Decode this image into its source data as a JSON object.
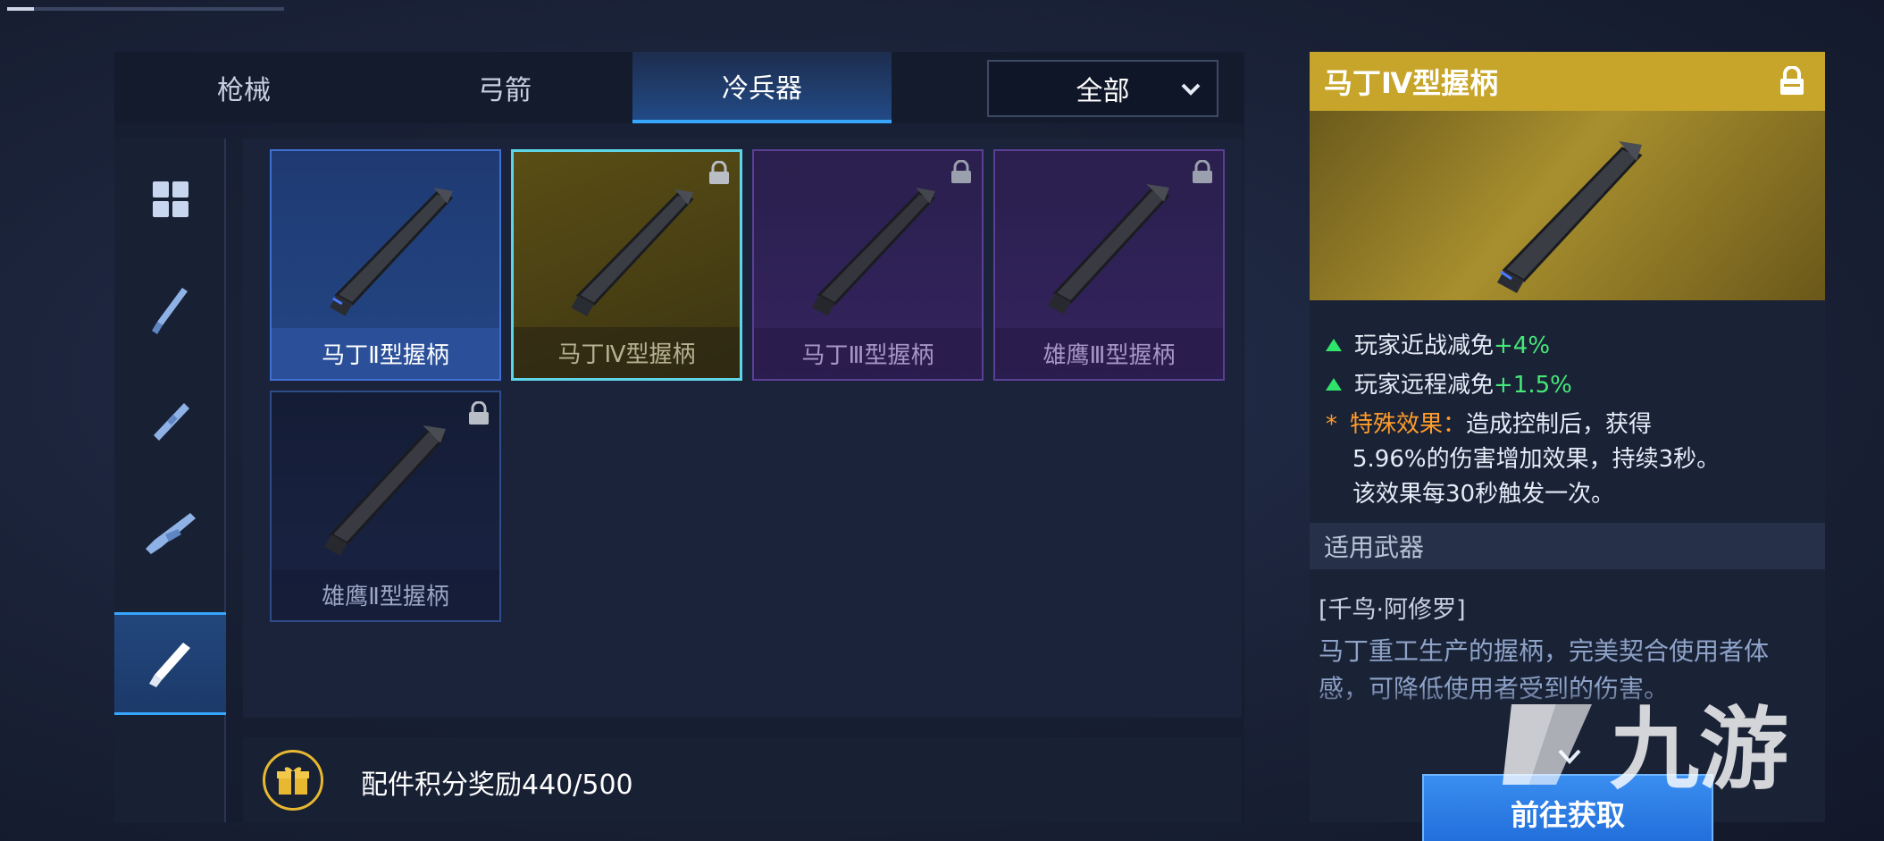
{
  "tabs": [
    {
      "label": "枪械",
      "active": false
    },
    {
      "label": "弓箭",
      "active": false
    },
    {
      "label": "冷兵器",
      "active": true
    }
  ],
  "filter": {
    "selected": "全部"
  },
  "category_icons": [
    "grid-icon",
    "blade-icon",
    "baton-icon",
    "rifle-icon",
    "grip-icon"
  ],
  "items": [
    {
      "name": "马丁Ⅱ型握柄",
      "rarity": "blue",
      "locked": false,
      "selected": false
    },
    {
      "name": "马丁Ⅳ型握柄",
      "rarity": "gold",
      "locked": true,
      "selected": true
    },
    {
      "name": "马丁Ⅲ型握柄",
      "rarity": "purple",
      "locked": true,
      "selected": false
    },
    {
      "name": "雄鹰Ⅲ型握柄",
      "rarity": "purple",
      "locked": true,
      "selected": false
    },
    {
      "name": "雄鹰Ⅱ型握柄",
      "rarity": "navy",
      "locked": true,
      "selected": false
    }
  ],
  "reward": {
    "text": "配件积分奖励440/500"
  },
  "detail": {
    "title": "马丁Ⅳ型握柄",
    "stats": [
      {
        "label": "玩家近战减免",
        "value": "+4%"
      },
      {
        "label": "玩家远程减免",
        "value": "+1.5%"
      }
    ],
    "special_key": "特殊效果：",
    "special_line1": "造成控制后，获得",
    "special_line2": "5.96%的伤害增加效果，持续3秒。",
    "special_line3": "该效果每30秒触发一次。",
    "applicable_title": "适用武器",
    "weapon": "[千鸟·阿修罗]",
    "description": "马丁重工生产的握柄，完美契合使用者体感，可降低使用者受到的伤害。",
    "acquire_label": "前往获取"
  },
  "watermark": "九游",
  "colors": {
    "accent": "#36a6ff",
    "gold_header": "#c7a52a",
    "stat_green": "#46e878",
    "special_orange": "#ff9c2a"
  }
}
